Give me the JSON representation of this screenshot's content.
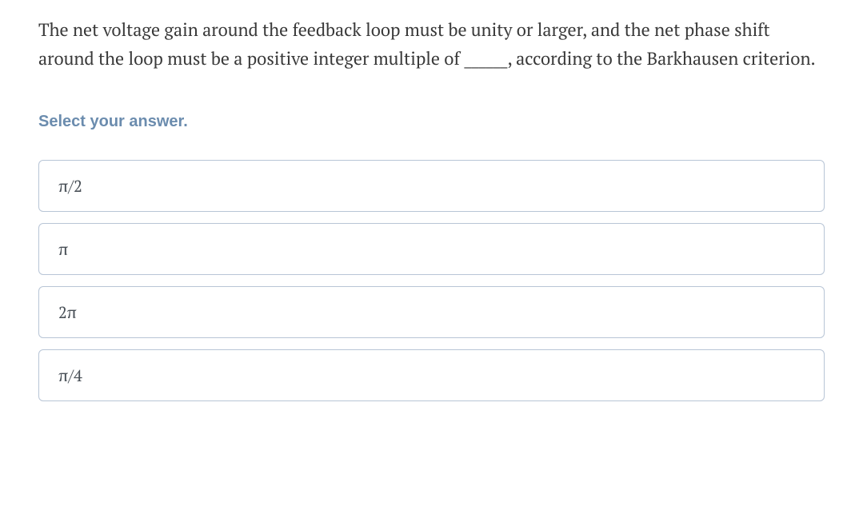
{
  "question": "The net voltage gain around the feedback loop must be unity or larger, and the net phase shift around the loop must be a positive integer multiple of ______, according to the Barkhausen criterion.",
  "prompt": "Select your answer.",
  "options": [
    {
      "label": "π/2"
    },
    {
      "label": "π"
    },
    {
      "label": "2π"
    },
    {
      "label": "π/4"
    }
  ]
}
